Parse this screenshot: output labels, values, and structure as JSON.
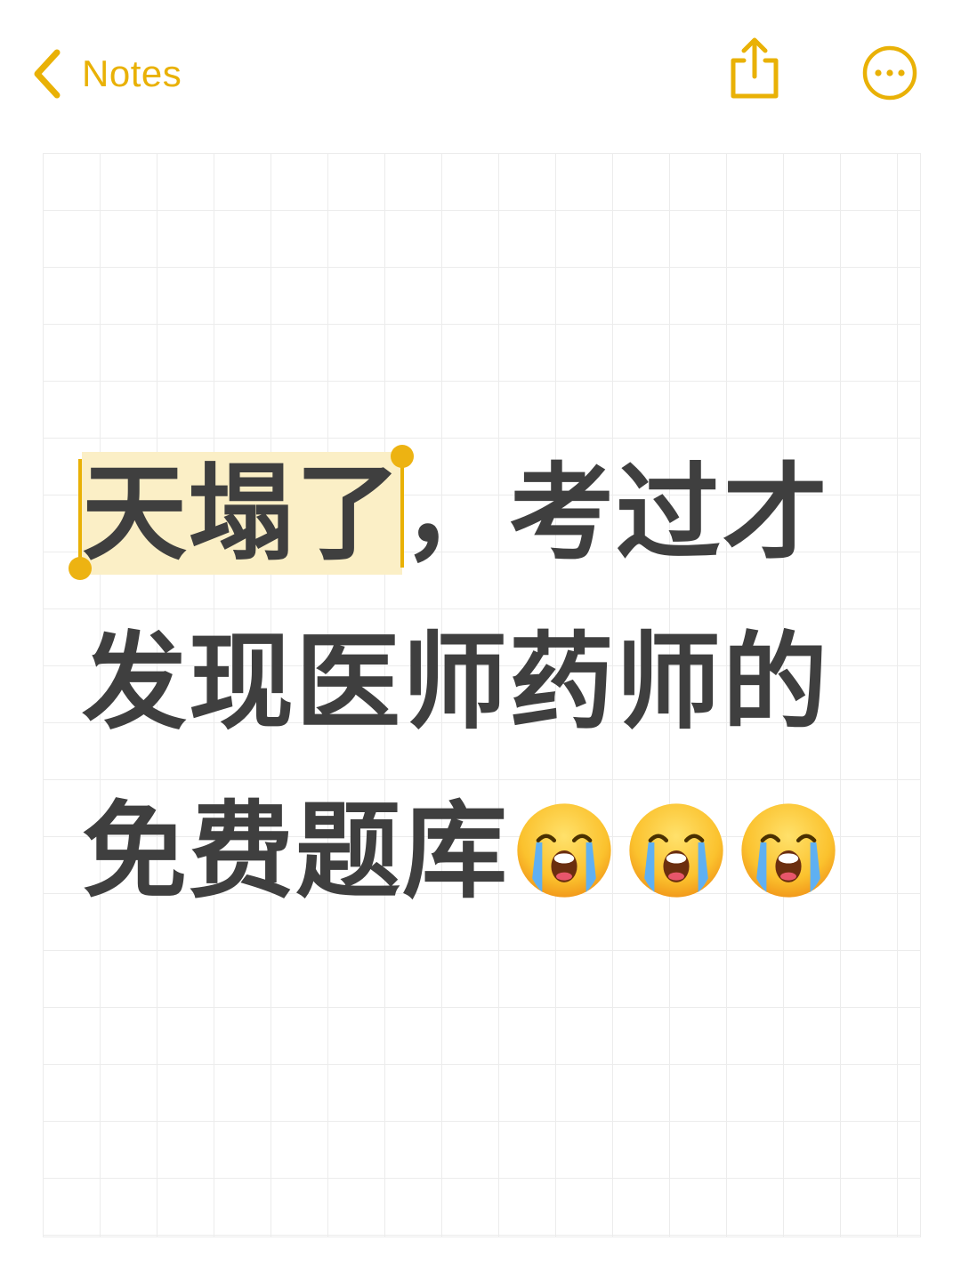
{
  "header": {
    "back_label": "Notes",
    "icons": {
      "back": "chevron-left-icon",
      "share": "share-icon",
      "more": "more-ellipsis-icon"
    }
  },
  "note": {
    "selected_text": "天塌了",
    "line1_rest": "，考过才",
    "line2": "发现医师药师的",
    "line3": "免费题库",
    "emoji_count": 3,
    "emoji_name": "loudly-crying-face-icon"
  },
  "colors": {
    "accent": "#E9B106",
    "text": "#3f3f3f",
    "selection": "#FBEFC6",
    "grid": "#ececec"
  }
}
